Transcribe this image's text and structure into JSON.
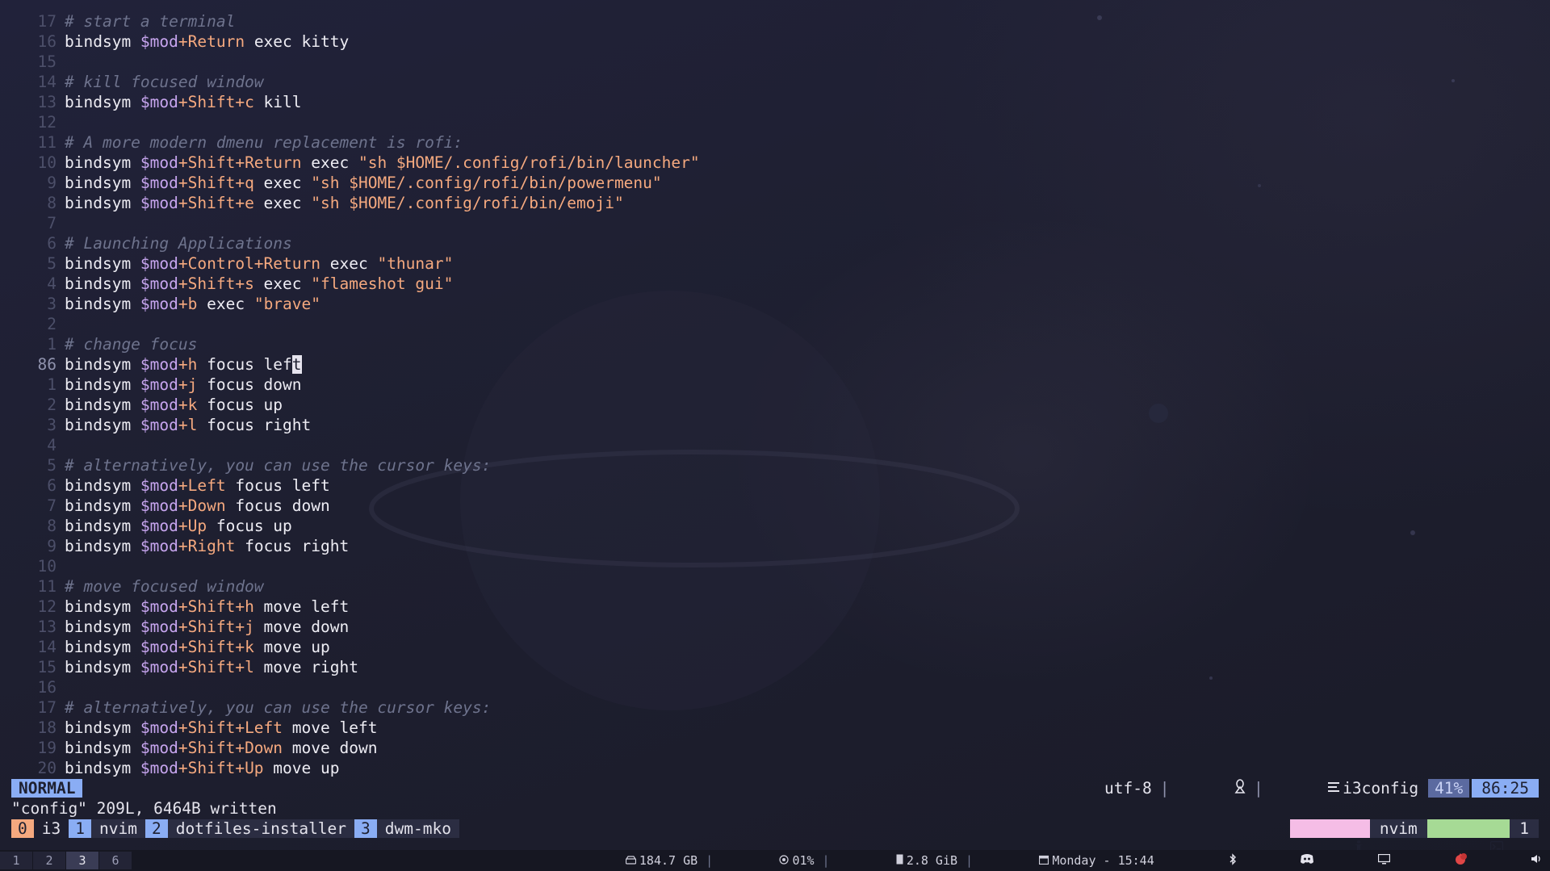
{
  "editor": {
    "lines": [
      {
        "n": "17",
        "parts": [
          {
            "t": "# start a terminal",
            "c": "cmt"
          }
        ]
      },
      {
        "n": "16",
        "parts": [
          {
            "t": "bindsym ",
            "c": "kw"
          },
          {
            "t": "$mod",
            "c": "var"
          },
          {
            "t": "+Return",
            "c": "mod"
          },
          {
            "t": " exec kitty",
            "c": "kw"
          }
        ]
      },
      {
        "n": "15",
        "parts": []
      },
      {
        "n": "14",
        "parts": [
          {
            "t": "# kill focused window",
            "c": "cmt"
          }
        ]
      },
      {
        "n": "13",
        "parts": [
          {
            "t": "bindsym ",
            "c": "kw"
          },
          {
            "t": "$mod",
            "c": "var"
          },
          {
            "t": "+Shift+c",
            "c": "mod"
          },
          {
            "t": " kill",
            "c": "kw"
          }
        ]
      },
      {
        "n": "12",
        "parts": []
      },
      {
        "n": "11",
        "parts": [
          {
            "t": "# A more modern dmenu replacement is rofi:",
            "c": "cmt"
          }
        ]
      },
      {
        "n": "10",
        "parts": [
          {
            "t": "bindsym ",
            "c": "kw"
          },
          {
            "t": "$mod",
            "c": "var"
          },
          {
            "t": "+Shift+Return",
            "c": "mod"
          },
          {
            "t": " exec ",
            "c": "kw"
          },
          {
            "t": "\"sh $HOME/.config/rofi/bin/launcher\"",
            "c": "str"
          }
        ]
      },
      {
        "n": "9",
        "parts": [
          {
            "t": "bindsym ",
            "c": "kw"
          },
          {
            "t": "$mod",
            "c": "var"
          },
          {
            "t": "+Shift+q",
            "c": "mod"
          },
          {
            "t": " exec ",
            "c": "kw"
          },
          {
            "t": "\"sh $HOME/.config/rofi/bin/powermenu\"",
            "c": "str"
          }
        ]
      },
      {
        "n": "8",
        "parts": [
          {
            "t": "bindsym ",
            "c": "kw"
          },
          {
            "t": "$mod",
            "c": "var"
          },
          {
            "t": "+Shift+e",
            "c": "mod"
          },
          {
            "t": " exec ",
            "c": "kw"
          },
          {
            "t": "\"sh $HOME/.config/rofi/bin/emoji\"",
            "c": "str"
          }
        ]
      },
      {
        "n": "7",
        "parts": []
      },
      {
        "n": "6",
        "parts": [
          {
            "t": "# Launching Applications",
            "c": "cmt"
          }
        ]
      },
      {
        "n": "5",
        "parts": [
          {
            "t": "bindsym ",
            "c": "kw"
          },
          {
            "t": "$mod",
            "c": "var"
          },
          {
            "t": "+Control+Return",
            "c": "mod"
          },
          {
            "t": " exec ",
            "c": "kw"
          },
          {
            "t": "\"thunar\"",
            "c": "str"
          }
        ]
      },
      {
        "n": "4",
        "parts": [
          {
            "t": "bindsym ",
            "c": "kw"
          },
          {
            "t": "$mod",
            "c": "var"
          },
          {
            "t": "+Shift+s",
            "c": "mod"
          },
          {
            "t": " exec ",
            "c": "kw"
          },
          {
            "t": "\"flameshot gui\"",
            "c": "str"
          }
        ]
      },
      {
        "n": "3",
        "parts": [
          {
            "t": "bindsym ",
            "c": "kw"
          },
          {
            "t": "$mod",
            "c": "var"
          },
          {
            "t": "+b",
            "c": "mod"
          },
          {
            "t": " exec ",
            "c": "kw"
          },
          {
            "t": "\"brave\"",
            "c": "str"
          }
        ]
      },
      {
        "n": "2",
        "parts": []
      },
      {
        "n": "1",
        "parts": [
          {
            "t": "# change focus",
            "c": "cmt"
          }
        ]
      },
      {
        "n": "86",
        "current": true,
        "parts": [
          {
            "t": "bindsym ",
            "c": "kw"
          },
          {
            "t": "$mod",
            "c": "var"
          },
          {
            "t": "+h",
            "c": "mod"
          },
          {
            "t": " focus lef",
            "c": "kw"
          },
          {
            "t": "t",
            "c": "cursor"
          }
        ]
      },
      {
        "n": "1",
        "parts": [
          {
            "t": "bindsym ",
            "c": "kw"
          },
          {
            "t": "$mod",
            "c": "var"
          },
          {
            "t": "+j",
            "c": "mod"
          },
          {
            "t": " focus down",
            "c": "kw"
          }
        ]
      },
      {
        "n": "2",
        "parts": [
          {
            "t": "bindsym ",
            "c": "kw"
          },
          {
            "t": "$mod",
            "c": "var"
          },
          {
            "t": "+k",
            "c": "mod"
          },
          {
            "t": " focus up",
            "c": "kw"
          }
        ]
      },
      {
        "n": "3",
        "parts": [
          {
            "t": "bindsym ",
            "c": "kw"
          },
          {
            "t": "$mod",
            "c": "var"
          },
          {
            "t": "+l",
            "c": "mod"
          },
          {
            "t": " focus right",
            "c": "kw"
          }
        ]
      },
      {
        "n": "4",
        "parts": []
      },
      {
        "n": "5",
        "parts": [
          {
            "t": "# alternatively, you can use the cursor keys:",
            "c": "cmt"
          }
        ]
      },
      {
        "n": "6",
        "parts": [
          {
            "t": "bindsym ",
            "c": "kw"
          },
          {
            "t": "$mod",
            "c": "var"
          },
          {
            "t": "+Left",
            "c": "mod"
          },
          {
            "t": " focus left",
            "c": "kw"
          }
        ]
      },
      {
        "n": "7",
        "parts": [
          {
            "t": "bindsym ",
            "c": "kw"
          },
          {
            "t": "$mod",
            "c": "var"
          },
          {
            "t": "+Down",
            "c": "mod"
          },
          {
            "t": " focus down",
            "c": "kw"
          }
        ]
      },
      {
        "n": "8",
        "parts": [
          {
            "t": "bindsym ",
            "c": "kw"
          },
          {
            "t": "$mod",
            "c": "var"
          },
          {
            "t": "+Up",
            "c": "mod"
          },
          {
            "t": " focus up",
            "c": "kw"
          }
        ]
      },
      {
        "n": "9",
        "parts": [
          {
            "t": "bindsym ",
            "c": "kw"
          },
          {
            "t": "$mod",
            "c": "var"
          },
          {
            "t": "+Right",
            "c": "mod"
          },
          {
            "t": " focus right",
            "c": "kw"
          }
        ]
      },
      {
        "n": "10",
        "parts": []
      },
      {
        "n": "11",
        "parts": [
          {
            "t": "# move focused window",
            "c": "cmt"
          }
        ]
      },
      {
        "n": "12",
        "parts": [
          {
            "t": "bindsym ",
            "c": "kw"
          },
          {
            "t": "$mod",
            "c": "var"
          },
          {
            "t": "+Shift+h",
            "c": "mod"
          },
          {
            "t": " move left",
            "c": "kw"
          }
        ]
      },
      {
        "n": "13",
        "parts": [
          {
            "t": "bindsym ",
            "c": "kw"
          },
          {
            "t": "$mod",
            "c": "var"
          },
          {
            "t": "+Shift+j",
            "c": "mod"
          },
          {
            "t": " move down",
            "c": "kw"
          }
        ]
      },
      {
        "n": "14",
        "parts": [
          {
            "t": "bindsym ",
            "c": "kw"
          },
          {
            "t": "$mod",
            "c": "var"
          },
          {
            "t": "+Shift+k",
            "c": "mod"
          },
          {
            "t": " move up",
            "c": "kw"
          }
        ]
      },
      {
        "n": "15",
        "parts": [
          {
            "t": "bindsym ",
            "c": "kw"
          },
          {
            "t": "$mod",
            "c": "var"
          },
          {
            "t": "+Shift+l",
            "c": "mod"
          },
          {
            "t": " move right",
            "c": "kw"
          }
        ]
      },
      {
        "n": "16",
        "parts": []
      },
      {
        "n": "17",
        "parts": [
          {
            "t": "# alternatively, you can use the cursor keys:",
            "c": "cmt"
          }
        ]
      },
      {
        "n": "18",
        "parts": [
          {
            "t": "bindsym ",
            "c": "kw"
          },
          {
            "t": "$mod",
            "c": "var"
          },
          {
            "t": "+Shift+Left",
            "c": "mod"
          },
          {
            "t": " move left",
            "c": "kw"
          }
        ]
      },
      {
        "n": "19",
        "parts": [
          {
            "t": "bindsym ",
            "c": "kw"
          },
          {
            "t": "$mod",
            "c": "var"
          },
          {
            "t": "+Shift+Down",
            "c": "mod"
          },
          {
            "t": " move down",
            "c": "kw"
          }
        ]
      },
      {
        "n": "20",
        "parts": [
          {
            "t": "bindsym ",
            "c": "kw"
          },
          {
            "t": "$mod",
            "c": "var"
          },
          {
            "t": "+Shift+Up",
            "c": "mod"
          },
          {
            "t": " move up",
            "c": "kw"
          }
        ]
      }
    ]
  },
  "statusline": {
    "mode": "NORMAL",
    "filename": "config",
    "encoding": "utf-8",
    "sep": "|",
    "os_icon": "linux-penguin-icon",
    "filetype_icon": "lines-icon",
    "filetype": "i3config",
    "percent": "41%",
    "position": "86:25"
  },
  "cmdline": {
    "message": "\"config\" 209L, 6464B written"
  },
  "tmux": {
    "windows": [
      {
        "num": "0",
        "name": "i3",
        "active": true
      },
      {
        "num": "1",
        "name": "nvim",
        "active": false
      },
      {
        "num": "2",
        "name": "dotfiles-installer",
        "active": false
      },
      {
        "num": "3",
        "name": "dwm-mko",
        "active": false
      }
    ],
    "session_icon": "accessibility-person-icon",
    "session_name": "nvim",
    "pane_icon": "terminal-icon",
    "pane_count": "1"
  },
  "bar": {
    "workspaces": [
      {
        "label": "1",
        "focused": false
      },
      {
        "label": "2",
        "focused": false
      },
      {
        "label": "3",
        "focused": true
      },
      {
        "label": "6",
        "focused": false
      }
    ],
    "disk": "184.7 GB",
    "cpu": "01%",
    "memory": "2.8 GiB",
    "datetime": "Monday - 15:44",
    "sep": "|"
  },
  "colors": {
    "mode_bg": "#8aadf4",
    "keyword": "#eeedf4",
    "variable": "#c8a6f0",
    "modifier": "#f5a97f",
    "comment": "#6e738d",
    "tmux_active": "#f5a97f"
  }
}
